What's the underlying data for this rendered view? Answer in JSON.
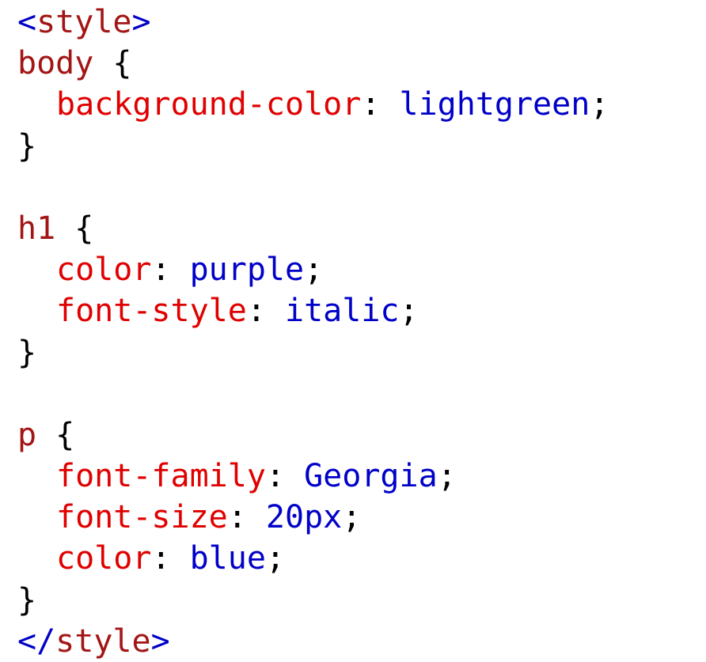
{
  "colors": {
    "tag_bracket": "#0000c8",
    "tag_name": "#a31515",
    "selector": "#a31515",
    "property": "#e00000",
    "value": "#0000c8",
    "punctuation": "#000000",
    "background": "#ffffff"
  },
  "code": {
    "lines": [
      {
        "type": "tag",
        "open": "<",
        "name": "style",
        "close": ">"
      },
      {
        "type": "selector",
        "selector": "body",
        "brace": " {"
      },
      {
        "type": "declaration",
        "property": "background-color",
        "colon": ": ",
        "value": "lightgreen",
        "semi": ";"
      },
      {
        "type": "brace",
        "text": "}"
      },
      {
        "type": "blank"
      },
      {
        "type": "selector",
        "selector": "h1",
        "brace": " {"
      },
      {
        "type": "declaration",
        "property": "color",
        "colon": ": ",
        "value": "purple",
        "semi": ";"
      },
      {
        "type": "declaration",
        "property": "font-style",
        "colon": ": ",
        "value": "italic",
        "semi": ";"
      },
      {
        "type": "brace",
        "text": "}"
      },
      {
        "type": "blank"
      },
      {
        "type": "selector",
        "selector": "p",
        "brace": " {"
      },
      {
        "type": "declaration",
        "property": "font-family",
        "colon": ": ",
        "value": "Georgia",
        "semi": ";"
      },
      {
        "type": "declaration",
        "property": "font-size",
        "colon": ": ",
        "value": "20px",
        "semi": ";"
      },
      {
        "type": "declaration",
        "property": "color",
        "colon": ": ",
        "value": "blue",
        "semi": ";"
      },
      {
        "type": "brace",
        "text": "}"
      },
      {
        "type": "tag",
        "open": "</",
        "name": "style",
        "close": ">"
      }
    ]
  }
}
